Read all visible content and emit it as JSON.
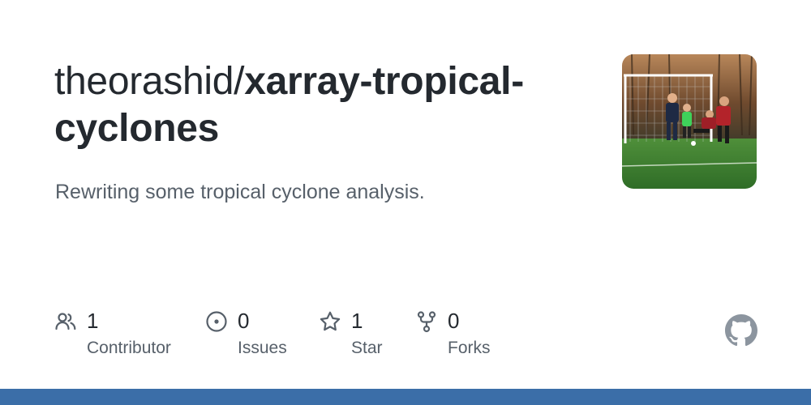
{
  "repo": {
    "owner": "theorashid/",
    "name": "xarray-tropical-cyclones",
    "description": "Rewriting some tropical cyclone analysis."
  },
  "stats": [
    {
      "icon": "contributors-icon",
      "count": "1",
      "label": "Contributor"
    },
    {
      "icon": "issues-icon",
      "count": "0",
      "label": "Issues"
    },
    {
      "icon": "star-icon",
      "count": "1",
      "label": "Star"
    },
    {
      "icon": "forks-icon",
      "count": "0",
      "label": "Forks"
    }
  ],
  "colors": {
    "text_primary": "#24292f",
    "text_secondary": "#57606a",
    "icon": "#57606a",
    "bottom_bar": "#3b6ea8",
    "github_logo": "#8c959f"
  },
  "icons": {
    "avatar": "avatar-photo",
    "brand": "github-logo-icon"
  }
}
